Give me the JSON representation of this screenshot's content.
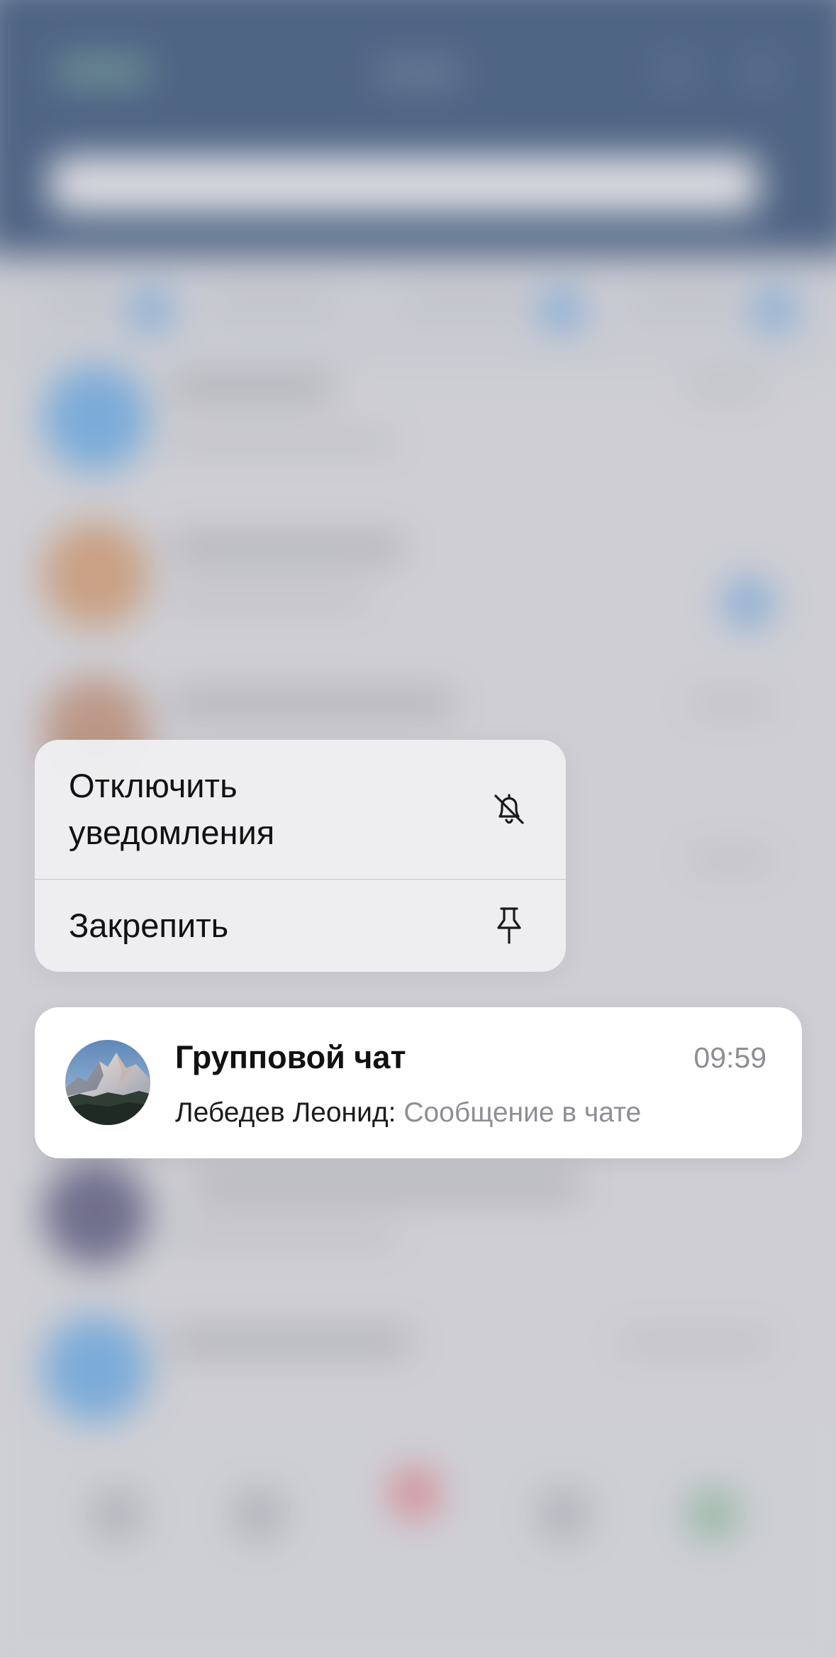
{
  "context_menu": {
    "mute_label_line1": "Отключить",
    "mute_label_line2": "уведомления",
    "mute_icon": "bell-slash-icon",
    "pin_label": "Закрепить",
    "pin_icon": "pin-icon"
  },
  "chat": {
    "title": "Групповой чат",
    "time": "09:59",
    "sender": "Лебедев Леонид:",
    "message": "Сообщение в чате",
    "avatar": "mountain-avatar"
  },
  "colors": {
    "header": "#1f3d66",
    "accent": "#6a9fd6",
    "secondary_text": "#8e8e93"
  }
}
